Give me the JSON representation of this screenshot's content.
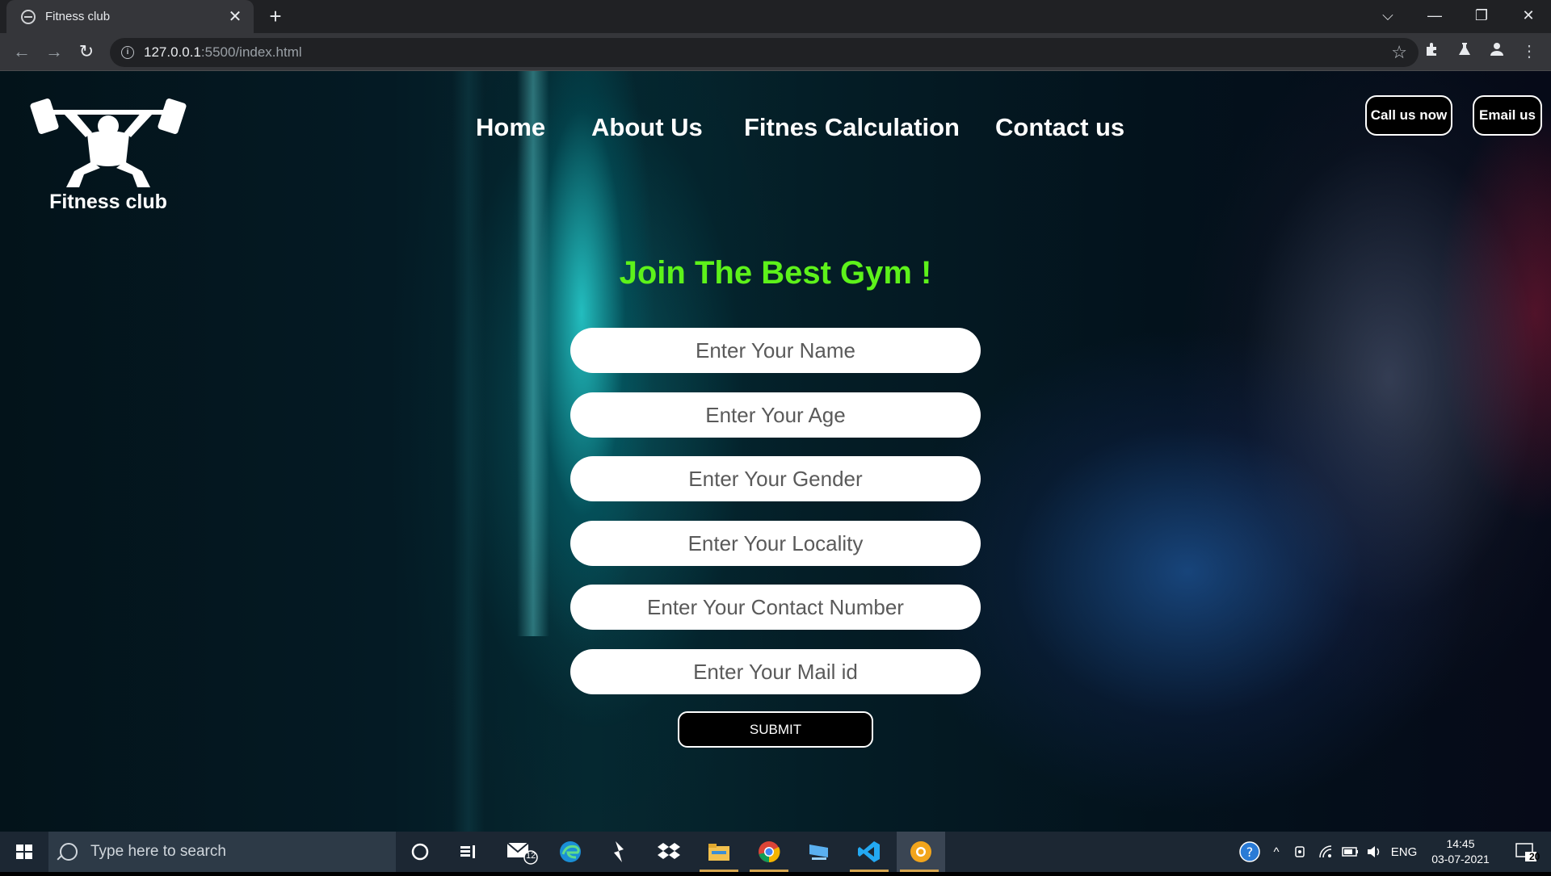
{
  "browser": {
    "tab_title": "Fitness club",
    "tab_close": "✕",
    "new_tab": "+",
    "url_host": "127.0.0.1",
    "url_path": ":5500/index.html",
    "window_controls": {
      "minimize": "—",
      "restore": "❐",
      "close": "✕",
      "tab_list": "⌵"
    }
  },
  "site": {
    "logo_text": "Fitness club",
    "nav": [
      "Home",
      "About Us",
      "Fitnes Calculation",
      "Contact us"
    ],
    "call_button": "Call us now",
    "email_button": "Email us",
    "heading": "Join The Best Gym !",
    "heading_color": "#5df21a",
    "form": {
      "fields": [
        {
          "placeholder": "Enter Your Name"
        },
        {
          "placeholder": "Enter Your Age"
        },
        {
          "placeholder": "Enter Your Gender"
        },
        {
          "placeholder": "Enter Your Locality"
        },
        {
          "placeholder": "Enter Your Contact Number"
        },
        {
          "placeholder": "Enter Your Mail id"
        }
      ],
      "submit": "SUBMIT"
    }
  },
  "taskbar": {
    "search_placeholder": "Type here to search",
    "mail_badge": "12",
    "language": "ENG",
    "time": "14:45",
    "date": "03-07-2021",
    "notifications": "20"
  }
}
